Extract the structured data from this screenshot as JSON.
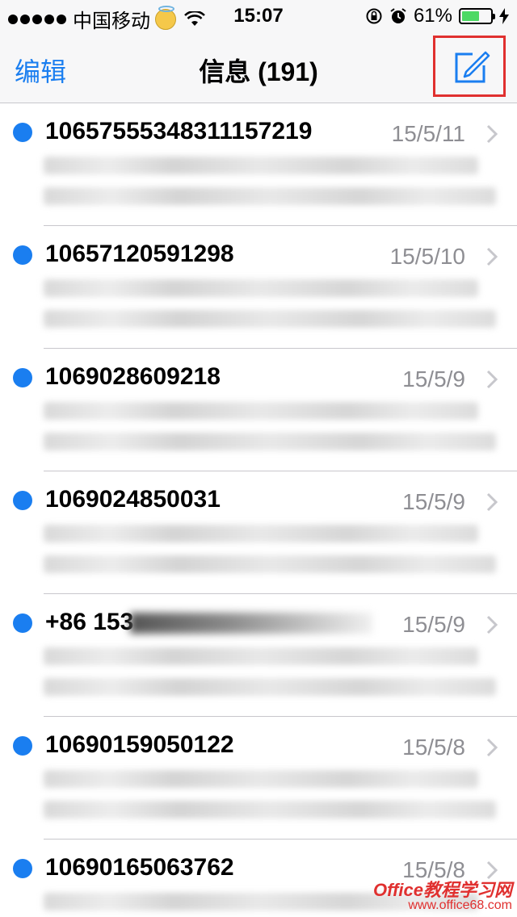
{
  "status_bar": {
    "carrier": "中国移动",
    "time": "15:07",
    "battery_percent_label": "61%",
    "battery_level": 0.61,
    "icons": [
      "signal-dots-icon",
      "emoji-angel-icon",
      "wifi-icon",
      "rotation-lock-icon",
      "alarm-icon",
      "battery-icon",
      "charging-bolt-icon"
    ]
  },
  "nav": {
    "edit_label": "编辑",
    "title": "信息 (191)",
    "compose_icon": "compose-icon",
    "accent_color": "#1a7ef0",
    "highlight_color": "#e0302f"
  },
  "messages": [
    {
      "sender": "10657555348311157219",
      "date": "15/5/11",
      "unread": true
    },
    {
      "sender": "10657120591298",
      "date": "15/5/10",
      "unread": true
    },
    {
      "sender": "1069028609218",
      "date": "15/5/9",
      "unread": true
    },
    {
      "sender": "1069024850031",
      "date": "15/5/9",
      "unread": true
    },
    {
      "sender": "+86 153",
      "date": "15/5/9",
      "unread": true
    },
    {
      "sender": "10690159050122",
      "date": "15/5/8",
      "unread": true
    },
    {
      "sender": "10690165063762",
      "date": "15/5/8",
      "unread": true
    }
  ],
  "watermark": {
    "main": "Office教程学习网",
    "sub": "www.office68.com"
  }
}
